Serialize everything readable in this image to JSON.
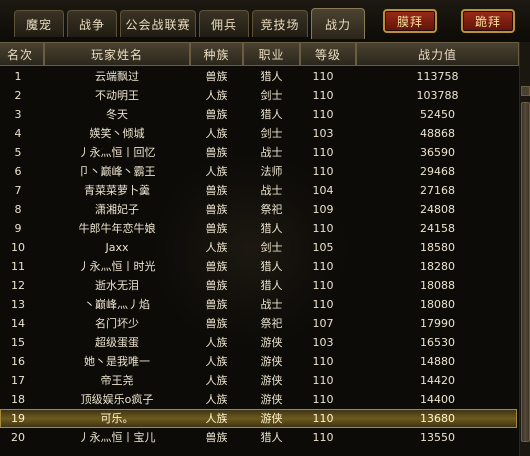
{
  "tabs": [
    {
      "label": "魔宠"
    },
    {
      "label": "战争"
    },
    {
      "label": "公会战联赛"
    },
    {
      "label": "佣兵"
    },
    {
      "label": "竞技场"
    },
    {
      "label": "战力"
    }
  ],
  "actions": {
    "worship": "膜拜",
    "kneel": "跪拜"
  },
  "table": {
    "columns": {
      "rank": "名次",
      "name": "玩家姓名",
      "race": "种族",
      "profession": "职业",
      "level": "等级",
      "power": "战力值"
    },
    "rows": [
      {
        "rank": "1",
        "name": "云端飘过",
        "race": "兽族",
        "profession": "猎人",
        "level": "110",
        "power": "113758"
      },
      {
        "rank": "2",
        "name": "不动明王",
        "race": "人族",
        "profession": "剑士",
        "level": "110",
        "power": "103788"
      },
      {
        "rank": "3",
        "name": "冬天",
        "race": "兽族",
        "profession": "猎人",
        "level": "110",
        "power": "52450"
      },
      {
        "rank": "4",
        "name": "媖笑丶倾城",
        "race": "人族",
        "profession": "剑士",
        "level": "103",
        "power": "48868"
      },
      {
        "rank": "5",
        "name": "丿永灬恒丨回忆",
        "race": "兽族",
        "profession": "战士",
        "level": "110",
        "power": "36590"
      },
      {
        "rank": "6",
        "name": "卩丶巅峰丶霸王",
        "race": "人族",
        "profession": "法师",
        "level": "110",
        "power": "29468"
      },
      {
        "rank": "7",
        "name": "青菜菜萝卜羹",
        "race": "兽族",
        "profession": "战士",
        "level": "104",
        "power": "27168"
      },
      {
        "rank": "8",
        "name": "潇湘妃子",
        "race": "兽族",
        "profession": "祭祀",
        "level": "109",
        "power": "24808"
      },
      {
        "rank": "9",
        "name": "牛郎牛年恋牛娘",
        "race": "兽族",
        "profession": "猎人",
        "level": "110",
        "power": "24158"
      },
      {
        "rank": "10",
        "name": "Jaxx",
        "race": "人族",
        "profession": "剑士",
        "level": "105",
        "power": "18580"
      },
      {
        "rank": "11",
        "name": "丿永灬恒丨时光",
        "race": "兽族",
        "profession": "猎人",
        "level": "110",
        "power": "18280"
      },
      {
        "rank": "12",
        "name": "逝水无泪",
        "race": "兽族",
        "profession": "猎人",
        "level": "110",
        "power": "18088"
      },
      {
        "rank": "13",
        "name": "丶巅峰灬丿焰",
        "race": "兽族",
        "profession": "战士",
        "level": "110",
        "power": "18080"
      },
      {
        "rank": "14",
        "name": "名门坏少",
        "race": "兽族",
        "profession": "祭祀",
        "level": "107",
        "power": "17990"
      },
      {
        "rank": "15",
        "name": "超级蛋蛋",
        "race": "人族",
        "profession": "游侠",
        "level": "103",
        "power": "16530"
      },
      {
        "rank": "16",
        "name": "她丶是我唯一",
        "race": "人族",
        "profession": "游侠",
        "level": "110",
        "power": "14880"
      },
      {
        "rank": "17",
        "name": "帝王尧",
        "race": "人族",
        "profession": "游侠",
        "level": "110",
        "power": "14420"
      },
      {
        "rank": "18",
        "name": "顶级娱乐o疯子",
        "race": "人族",
        "profession": "游侠",
        "level": "110",
        "power": "14400"
      },
      {
        "rank": "19",
        "name": "可乐。",
        "race": "人族",
        "profession": "游侠",
        "level": "110",
        "power": "13680"
      },
      {
        "rank": "20",
        "name": "丿永灬恒丨宝儿",
        "race": "兽族",
        "profession": "猎人",
        "level": "110",
        "power": "13550"
      }
    ]
  }
}
